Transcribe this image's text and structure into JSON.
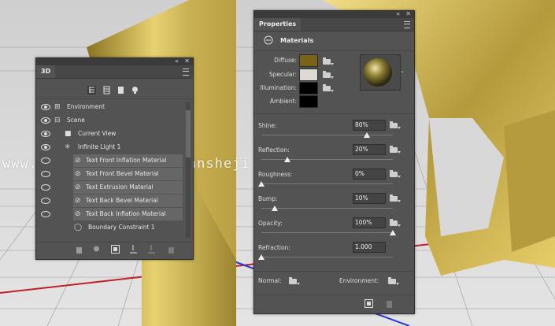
{
  "panel3d": {
    "title": "3D",
    "items": [
      {
        "label": "Environment",
        "icon": "environment-icon"
      },
      {
        "label": "Scene",
        "icon": "scene-icon"
      },
      {
        "label": "Current View",
        "icon": "camera-icon"
      },
      {
        "label": "Infinite Light 1",
        "icon": "light-icon"
      },
      {
        "label": "Text Front Inflation Material",
        "icon": "material-icon"
      },
      {
        "label": "Text Front Bevel Material",
        "icon": "material-icon"
      },
      {
        "label": "Text Extrusion Material",
        "icon": "material-icon"
      },
      {
        "label": "Text Back Bevel Material",
        "icon": "material-icon"
      },
      {
        "label": "Text Back Inflation Material",
        "icon": "material-icon"
      },
      {
        "label": "Boundary Constraint 1",
        "icon": "constraint-icon"
      }
    ]
  },
  "properties": {
    "title": "Properties",
    "section": "Materials",
    "diffuse_label": "Diffuse:",
    "specular_label": "Specular:",
    "illumination_label": "Illumination:",
    "ambient_label": "Ambient:",
    "colors": {
      "diffuse": "#7a6218",
      "specular": "#dcdad2",
      "illumination": "#000000",
      "ambient": "#000000"
    },
    "sliders": [
      {
        "label": "Shine:",
        "value": "80%",
        "level": 0.8
      },
      {
        "label": "Reflection:",
        "value": "20%",
        "level": 0.2
      },
      {
        "label": "Roughness:",
        "value": "0%",
        "level": 0.0
      },
      {
        "label": "Bump:",
        "value": "10%",
        "level": 0.1
      },
      {
        "label": "Opacity:",
        "value": "100%",
        "level": 1.0
      },
      {
        "label": "Refraction:",
        "value": "1.000",
        "level": 0.0
      }
    ],
    "normal_label": "Normal:",
    "environment_label": "Environment:"
  },
  "watermark": "www.psahz.com  haoyidiansheji.com"
}
